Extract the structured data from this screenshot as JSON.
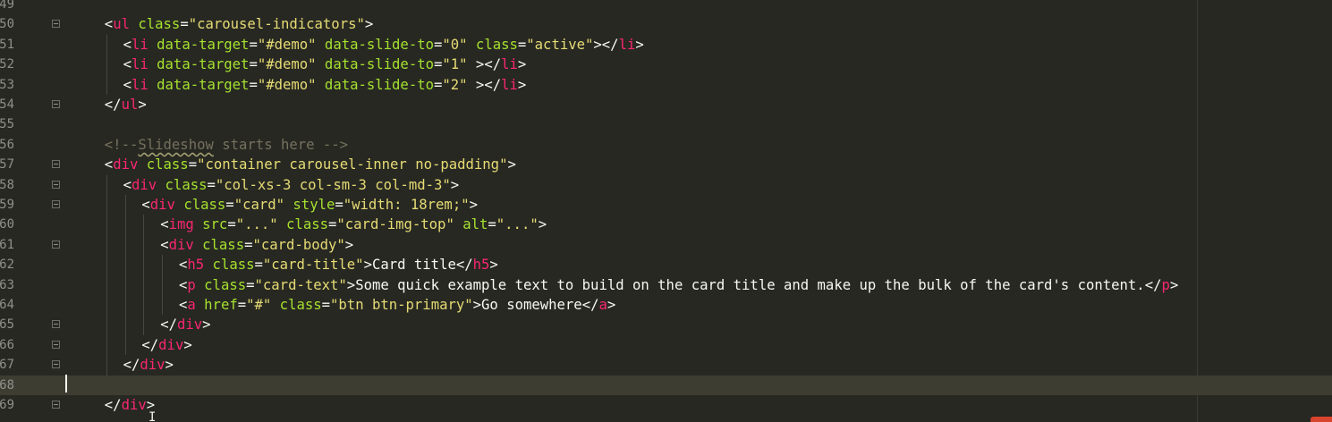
{
  "lines": [
    {
      "num": "49",
      "fold": "",
      "indent": 0,
      "tokens": []
    },
    {
      "num": "50",
      "fold": "start",
      "indent": 1,
      "tokens": [
        {
          "t": "<",
          "c": "pu"
        },
        {
          "t": "ul",
          "c": "tg"
        },
        {
          "t": " class",
          "c": "at"
        },
        {
          "t": "=",
          "c": "pu"
        },
        {
          "t": "\"carousel-indicators\"",
          "c": "st"
        },
        {
          "t": ">",
          "c": "pu"
        }
      ]
    },
    {
      "num": "51",
      "fold": "",
      "indent": 2,
      "tokens": [
        {
          "t": "<",
          "c": "pu"
        },
        {
          "t": "li",
          "c": "tg"
        },
        {
          "t": " data-target",
          "c": "at"
        },
        {
          "t": "=",
          "c": "pu"
        },
        {
          "t": "\"#demo\"",
          "c": "st"
        },
        {
          "t": " data-slide-to",
          "c": "at"
        },
        {
          "t": "=",
          "c": "pu"
        },
        {
          "t": "\"0\"",
          "c": "st"
        },
        {
          "t": " class",
          "c": "at"
        },
        {
          "t": "=",
          "c": "pu"
        },
        {
          "t": "\"active\"",
          "c": "st"
        },
        {
          "t": "></",
          "c": "pu"
        },
        {
          "t": "li",
          "c": "tg"
        },
        {
          "t": ">",
          "c": "pu"
        }
      ]
    },
    {
      "num": "52",
      "fold": "",
      "indent": 2,
      "tokens": [
        {
          "t": "<",
          "c": "pu"
        },
        {
          "t": "li",
          "c": "tg"
        },
        {
          "t": " data-target",
          "c": "at"
        },
        {
          "t": "=",
          "c": "pu"
        },
        {
          "t": "\"#demo\"",
          "c": "st"
        },
        {
          "t": " data-slide-to",
          "c": "at"
        },
        {
          "t": "=",
          "c": "pu"
        },
        {
          "t": "\"1\"",
          "c": "st"
        },
        {
          "t": " ></",
          "c": "pu"
        },
        {
          "t": "li",
          "c": "tg"
        },
        {
          "t": ">",
          "c": "pu"
        }
      ]
    },
    {
      "num": "53",
      "fold": "",
      "indent": 2,
      "tokens": [
        {
          "t": "<",
          "c": "pu"
        },
        {
          "t": "li",
          "c": "tg"
        },
        {
          "t": " data-target",
          "c": "at"
        },
        {
          "t": "=",
          "c": "pu"
        },
        {
          "t": "\"#demo\"",
          "c": "st"
        },
        {
          "t": " data-slide-to",
          "c": "at"
        },
        {
          "t": "=",
          "c": "pu"
        },
        {
          "t": "\"2\"",
          "c": "st"
        },
        {
          "t": " ></",
          "c": "pu"
        },
        {
          "t": "li",
          "c": "tg"
        },
        {
          "t": ">",
          "c": "pu"
        }
      ]
    },
    {
      "num": "54",
      "fold": "end",
      "indent": 1,
      "tokens": [
        {
          "t": "</",
          "c": "pu"
        },
        {
          "t": "ul",
          "c": "tg"
        },
        {
          "t": ">",
          "c": "pu"
        }
      ]
    },
    {
      "num": "55",
      "fold": "",
      "indent": 0,
      "tokens": []
    },
    {
      "num": "56",
      "fold": "",
      "indent": 1,
      "tokens": [
        {
          "t": "<!--",
          "c": "cm"
        },
        {
          "t": "Slideshow",
          "c": "cm-u"
        },
        {
          "t": " starts here -->",
          "c": "cm"
        }
      ]
    },
    {
      "num": "57",
      "fold": "start",
      "indent": 1,
      "tokens": [
        {
          "t": "<",
          "c": "pu"
        },
        {
          "t": "div",
          "c": "tg"
        },
        {
          "t": " class",
          "c": "at"
        },
        {
          "t": "=",
          "c": "pu"
        },
        {
          "t": "\"container carousel-inner no-padding\"",
          "c": "st"
        },
        {
          "t": ">",
          "c": "pu"
        }
      ]
    },
    {
      "num": "58",
      "fold": "start",
      "indent": 2,
      "tokens": [
        {
          "t": "<",
          "c": "pu"
        },
        {
          "t": "div",
          "c": "tg"
        },
        {
          "t": " class",
          "c": "at"
        },
        {
          "t": "=",
          "c": "pu"
        },
        {
          "t": "\"col-xs-3 col-sm-3 col-md-3\"",
          "c": "st"
        },
        {
          "t": ">",
          "c": "pu"
        }
      ]
    },
    {
      "num": "59",
      "fold": "start",
      "indent": 3,
      "tokens": [
        {
          "t": "<",
          "c": "pu"
        },
        {
          "t": "div",
          "c": "tg"
        },
        {
          "t": " class",
          "c": "at"
        },
        {
          "t": "=",
          "c": "pu"
        },
        {
          "t": "\"card\"",
          "c": "st"
        },
        {
          "t": " style",
          "c": "at"
        },
        {
          "t": "=",
          "c": "pu"
        },
        {
          "t": "\"width: 18rem;\"",
          "c": "st"
        },
        {
          "t": ">",
          "c": "pu"
        }
      ]
    },
    {
      "num": "60",
      "fold": "",
      "indent": 4,
      "tokens": [
        {
          "t": "<",
          "c": "pu"
        },
        {
          "t": "img",
          "c": "tg"
        },
        {
          "t": " src",
          "c": "at"
        },
        {
          "t": "=",
          "c": "pu"
        },
        {
          "t": "\"...\"",
          "c": "st"
        },
        {
          "t": " class",
          "c": "at"
        },
        {
          "t": "=",
          "c": "pu"
        },
        {
          "t": "\"card-img-top\"",
          "c": "st"
        },
        {
          "t": " alt",
          "c": "at"
        },
        {
          "t": "=",
          "c": "pu"
        },
        {
          "t": "\"...\"",
          "c": "st"
        },
        {
          "t": ">",
          "c": "pu"
        }
      ]
    },
    {
      "num": "61",
      "fold": "start",
      "indent": 4,
      "tokens": [
        {
          "t": "<",
          "c": "pu"
        },
        {
          "t": "div",
          "c": "tg"
        },
        {
          "t": " class",
          "c": "at"
        },
        {
          "t": "=",
          "c": "pu"
        },
        {
          "t": "\"card-body\"",
          "c": "st"
        },
        {
          "t": ">",
          "c": "pu"
        }
      ]
    },
    {
      "num": "62",
      "fold": "",
      "indent": 5,
      "tokens": [
        {
          "t": "<",
          "c": "pu"
        },
        {
          "t": "h5",
          "c": "tg"
        },
        {
          "t": " class",
          "c": "at"
        },
        {
          "t": "=",
          "c": "pu"
        },
        {
          "t": "\"card-title\"",
          "c": "st"
        },
        {
          "t": ">",
          "c": "pu"
        },
        {
          "t": "Card title",
          "c": "tx"
        },
        {
          "t": "</",
          "c": "pu"
        },
        {
          "t": "h5",
          "c": "tg"
        },
        {
          "t": ">",
          "c": "pu"
        }
      ]
    },
    {
      "num": "63",
      "fold": "",
      "indent": 5,
      "tokens": [
        {
          "t": "<",
          "c": "pu"
        },
        {
          "t": "p",
          "c": "tg"
        },
        {
          "t": " class",
          "c": "at"
        },
        {
          "t": "=",
          "c": "pu"
        },
        {
          "t": "\"card-text\"",
          "c": "st"
        },
        {
          "t": ">",
          "c": "pu"
        },
        {
          "t": "Some quick example text to build on the card title and make up the bulk of the card's content.",
          "c": "tx"
        },
        {
          "t": "</",
          "c": "pu"
        },
        {
          "t": "p",
          "c": "tg"
        },
        {
          "t": ">",
          "c": "pu"
        }
      ]
    },
    {
      "num": "64",
      "fold": "",
      "indent": 5,
      "tokens": [
        {
          "t": "<",
          "c": "pu"
        },
        {
          "t": "a",
          "c": "tg"
        },
        {
          "t": " href",
          "c": "at"
        },
        {
          "t": "=",
          "c": "pu"
        },
        {
          "t": "\"#\"",
          "c": "st"
        },
        {
          "t": " class",
          "c": "at"
        },
        {
          "t": "=",
          "c": "pu"
        },
        {
          "t": "\"btn btn-primary\"",
          "c": "st"
        },
        {
          "t": ">",
          "c": "pu"
        },
        {
          "t": "Go somewhere",
          "c": "tx"
        },
        {
          "t": "</",
          "c": "pu"
        },
        {
          "t": "a",
          "c": "tg"
        },
        {
          "t": ">",
          "c": "pu"
        }
      ]
    },
    {
      "num": "65",
      "fold": "end",
      "indent": 4,
      "tokens": [
        {
          "t": "</",
          "c": "pu"
        },
        {
          "t": "div",
          "c": "tg"
        },
        {
          "t": ">",
          "c": "pu"
        }
      ]
    },
    {
      "num": "66",
      "fold": "end",
      "indent": 3,
      "tokens": [
        {
          "t": "</",
          "c": "pu"
        },
        {
          "t": "div",
          "c": "tg"
        },
        {
          "t": ">",
          "c": "pu"
        }
      ]
    },
    {
      "num": "67",
      "fold": "end",
      "indent": 2,
      "tokens": [
        {
          "t": "</",
          "c": "pu"
        },
        {
          "t": "div",
          "c": "tg"
        },
        {
          "t": ">",
          "c": "pu"
        }
      ]
    },
    {
      "num": "68",
      "fold": "",
      "indent": 0,
      "current": true,
      "tokens": []
    },
    {
      "num": "69",
      "fold": "end",
      "indent": 1,
      "tokens": [
        {
          "t": "</",
          "c": "pu"
        },
        {
          "t": "div",
          "c": "tg"
        },
        {
          "t": ">",
          "c": "pu"
        }
      ]
    }
  ],
  "theme": {
    "background": "#272822",
    "current_line": "#3e3d32",
    "tag": "#f92672",
    "attribute": "#a6e22e",
    "string": "#e6db74",
    "comment": "#75715e",
    "text": "#f8f8f2",
    "line_number": "#8f908a"
  }
}
